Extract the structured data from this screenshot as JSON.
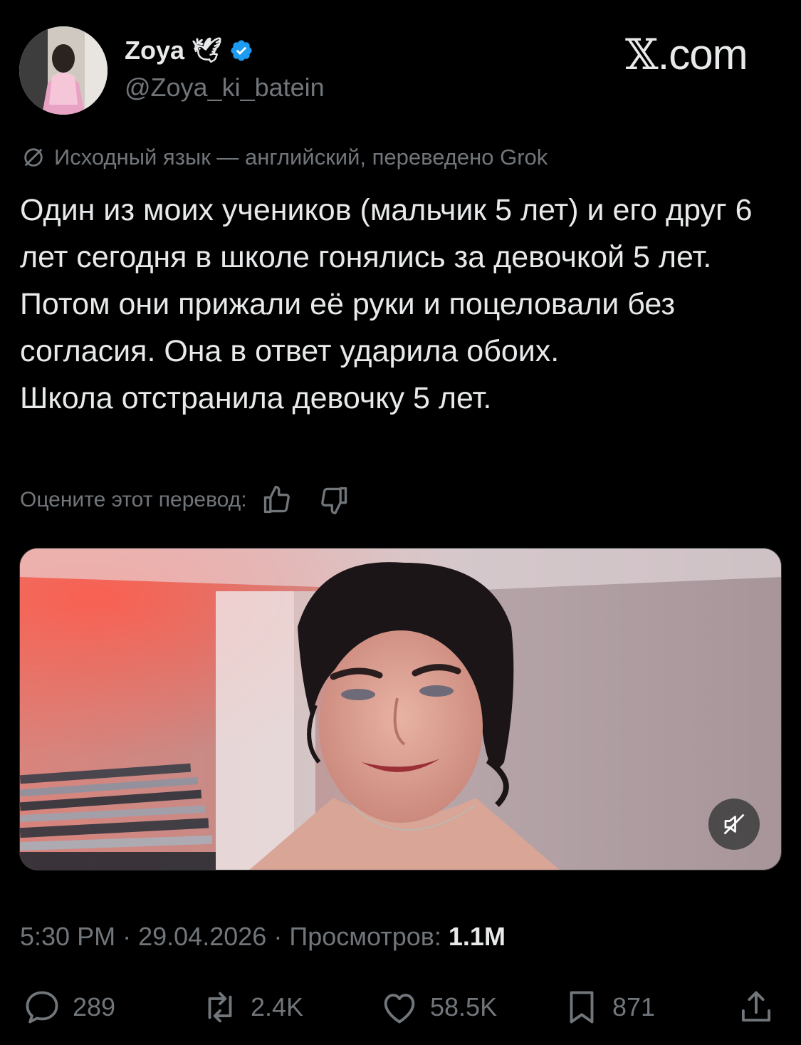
{
  "header": {
    "display_name": "Zoya",
    "handle": "@Zoya_ki_batein",
    "watermark": "X.com",
    "colors": {
      "verified": "#1d9bf0",
      "muted": "#71767b",
      "text": "#e7e9ea"
    }
  },
  "translation": {
    "notice": "Исходный язык — английский, переведено Grok",
    "rate_label": "Оцените этот перевод:"
  },
  "tweet": {
    "paragraphs": [
      "Один из моих учеников (мальчик 5 лет) и его друг 6 лет сегодня в школе гонялись за девочкой 5 лет. Потом они прижали её руки и поцеловали без согласия. Она в ответ ударила обоих.",
      "Школа отстранила девочку 5 лет."
    ]
  },
  "meta": {
    "time": "5:30 PM",
    "separator": "·",
    "date": "29.04.2026",
    "views_label": "Просмотров:",
    "views_value": "1.1M"
  },
  "actions": {
    "replies": "289",
    "reposts": "2.4K",
    "likes": "58.5K",
    "bookmarks": "871"
  },
  "icons": {
    "verified": "verified-badge-icon",
    "dove": "dove-emoji-icon",
    "translate": "translate-off-icon",
    "like_translation": "thumbs-up-icon",
    "dislike_translation": "thumbs-down-icon",
    "mute": "muted-speaker-icon",
    "reply": "reply-icon",
    "repost": "repost-icon",
    "like": "heart-icon",
    "bookmark": "bookmark-icon",
    "share": "share-icon"
  }
}
